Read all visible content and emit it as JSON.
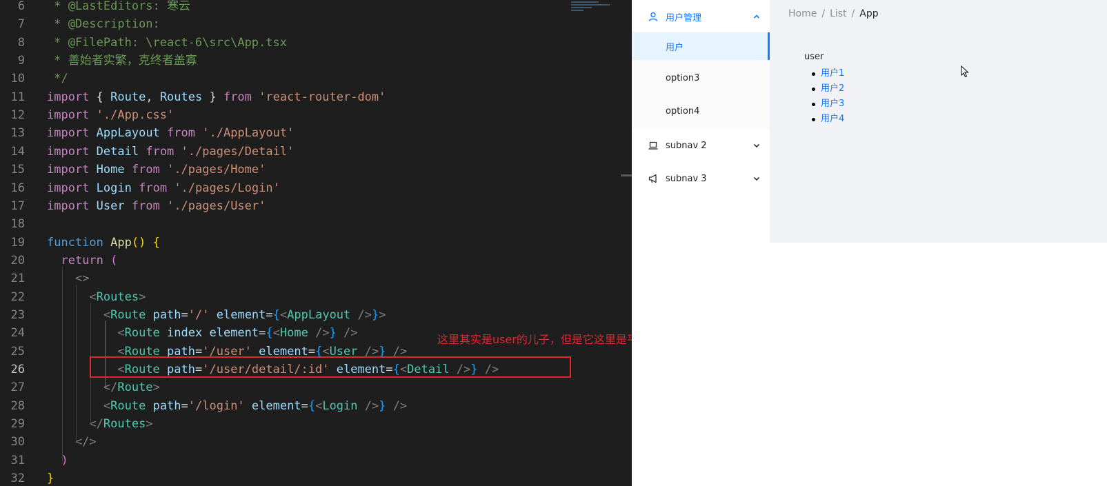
{
  "editor": {
    "lines": [
      {
        "num": "6",
        "tokens": [
          {
            "t": " * @LastEditors: 寒云",
            "c": "c-comment"
          }
        ]
      },
      {
        "num": "7",
        "tokens": [
          {
            "t": " * @Description:",
            "c": "c-comment"
          }
        ]
      },
      {
        "num": "8",
        "tokens": [
          {
            "t": " * @FilePath: \\react-6\\src\\App.tsx",
            "c": "c-comment"
          }
        ]
      },
      {
        "num": "9",
        "tokens": [
          {
            "t": " * 善始者实繁，克终者盖寡",
            "c": "c-comment"
          }
        ]
      },
      {
        "num": "10",
        "tokens": [
          {
            "t": " */",
            "c": "c-comment"
          }
        ]
      },
      {
        "num": "11",
        "tokens": [
          {
            "t": "import",
            "c": "c-kw"
          },
          {
            "t": " { ",
            "c": "c-id"
          },
          {
            "t": "Route",
            "c": "c-var"
          },
          {
            "t": ", ",
            "c": "c-id"
          },
          {
            "t": "Routes",
            "c": "c-var"
          },
          {
            "t": " } ",
            "c": "c-id"
          },
          {
            "t": "from",
            "c": "c-kw"
          },
          {
            "t": " ",
            "c": "c-id"
          },
          {
            "t": "'react-router-dom'",
            "c": "c-str"
          }
        ]
      },
      {
        "num": "12",
        "tokens": [
          {
            "t": "import",
            "c": "c-kw"
          },
          {
            "t": " ",
            "c": "c-id"
          },
          {
            "t": "'./App.css'",
            "c": "c-str"
          }
        ]
      },
      {
        "num": "13",
        "tokens": [
          {
            "t": "import",
            "c": "c-kw"
          },
          {
            "t": " ",
            "c": "c-id"
          },
          {
            "t": "AppLayout",
            "c": "c-var"
          },
          {
            "t": " ",
            "c": "c-id"
          },
          {
            "t": "from",
            "c": "c-kw"
          },
          {
            "t": " ",
            "c": "c-id"
          },
          {
            "t": "'./AppLayout'",
            "c": "c-str"
          }
        ]
      },
      {
        "num": "14",
        "tokens": [
          {
            "t": "import",
            "c": "c-kw"
          },
          {
            "t": " ",
            "c": "c-id"
          },
          {
            "t": "Detail",
            "c": "c-var"
          },
          {
            "t": " ",
            "c": "c-id"
          },
          {
            "t": "from",
            "c": "c-kw"
          },
          {
            "t": " ",
            "c": "c-id"
          },
          {
            "t": "'./pages/Detail'",
            "c": "c-str"
          }
        ]
      },
      {
        "num": "15",
        "tokens": [
          {
            "t": "import",
            "c": "c-kw"
          },
          {
            "t": " ",
            "c": "c-id"
          },
          {
            "t": "Home",
            "c": "c-var"
          },
          {
            "t": " ",
            "c": "c-id"
          },
          {
            "t": "from",
            "c": "c-kw"
          },
          {
            "t": " ",
            "c": "c-id"
          },
          {
            "t": "'./pages/Home'",
            "c": "c-str"
          }
        ]
      },
      {
        "num": "16",
        "tokens": [
          {
            "t": "import",
            "c": "c-kw"
          },
          {
            "t": " ",
            "c": "c-id"
          },
          {
            "t": "Login",
            "c": "c-var"
          },
          {
            "t": " ",
            "c": "c-id"
          },
          {
            "t": "from",
            "c": "c-kw"
          },
          {
            "t": " ",
            "c": "c-id"
          },
          {
            "t": "'./pages/Login'",
            "c": "c-str"
          }
        ]
      },
      {
        "num": "17",
        "tokens": [
          {
            "t": "import",
            "c": "c-kw"
          },
          {
            "t": " ",
            "c": "c-id"
          },
          {
            "t": "User",
            "c": "c-var"
          },
          {
            "t": " ",
            "c": "c-id"
          },
          {
            "t": "from",
            "c": "c-kw"
          },
          {
            "t": " ",
            "c": "c-id"
          },
          {
            "t": "'./pages/User'",
            "c": "c-str"
          }
        ]
      },
      {
        "num": "18",
        "tokens": []
      },
      {
        "num": "19",
        "tokens": [
          {
            "t": "function",
            "c": "c-kw2"
          },
          {
            "t": " ",
            "c": "c-id"
          },
          {
            "t": "App",
            "c": "c-fn"
          },
          {
            "t": "() {",
            "c": "c-brace"
          }
        ]
      },
      {
        "num": "20",
        "tokens": [
          {
            "t": "  ",
            "c": "c-id"
          },
          {
            "t": "return",
            "c": "c-kw"
          },
          {
            "t": " (",
            "c": "c-brace2"
          }
        ]
      },
      {
        "num": "21",
        "tokens": [
          {
            "t": "    ",
            "c": "c-id"
          },
          {
            "t": "<>",
            "c": "c-punc"
          }
        ]
      },
      {
        "num": "22",
        "tokens": [
          {
            "t": "      ",
            "c": "c-id"
          },
          {
            "t": "<",
            "c": "c-punc"
          },
          {
            "t": "Routes",
            "c": "c-tag"
          },
          {
            "t": ">",
            "c": "c-punc"
          }
        ]
      },
      {
        "num": "23",
        "tokens": [
          {
            "t": "        ",
            "c": "c-id"
          },
          {
            "t": "<",
            "c": "c-punc"
          },
          {
            "t": "Route",
            "c": "c-tag"
          },
          {
            "t": " ",
            "c": "c-id"
          },
          {
            "t": "path",
            "c": "c-var"
          },
          {
            "t": "=",
            "c": "c-id"
          },
          {
            "t": "'/'",
            "c": "c-str"
          },
          {
            "t": " ",
            "c": "c-id"
          },
          {
            "t": "element",
            "c": "c-var"
          },
          {
            "t": "=",
            "c": "c-id"
          },
          {
            "t": "{",
            "c": "c-brace3"
          },
          {
            "t": "<",
            "c": "c-punc"
          },
          {
            "t": "AppLayout",
            "c": "c-tag"
          },
          {
            "t": " />",
            "c": "c-punc"
          },
          {
            "t": "}",
            "c": "c-brace3"
          },
          {
            "t": ">",
            "c": "c-punc"
          }
        ]
      },
      {
        "num": "24",
        "tokens": [
          {
            "t": "          ",
            "c": "c-id"
          },
          {
            "t": "<",
            "c": "c-punc"
          },
          {
            "t": "Route",
            "c": "c-tag"
          },
          {
            "t": " ",
            "c": "c-id"
          },
          {
            "t": "index",
            "c": "c-var"
          },
          {
            "t": " ",
            "c": "c-id"
          },
          {
            "t": "element",
            "c": "c-var"
          },
          {
            "t": "=",
            "c": "c-id"
          },
          {
            "t": "{",
            "c": "c-brace3"
          },
          {
            "t": "<",
            "c": "c-punc"
          },
          {
            "t": "Home",
            "c": "c-tag"
          },
          {
            "t": " />",
            "c": "c-punc"
          },
          {
            "t": "}",
            "c": "c-brace3"
          },
          {
            "t": " />",
            "c": "c-punc"
          }
        ]
      },
      {
        "num": "25",
        "tokens": [
          {
            "t": "          ",
            "c": "c-id"
          },
          {
            "t": "<",
            "c": "c-punc"
          },
          {
            "t": "Route",
            "c": "c-tag"
          },
          {
            "t": " ",
            "c": "c-id"
          },
          {
            "t": "path",
            "c": "c-var"
          },
          {
            "t": "=",
            "c": "c-id"
          },
          {
            "t": "'/user'",
            "c": "c-str"
          },
          {
            "t": " ",
            "c": "c-id"
          },
          {
            "t": "element",
            "c": "c-var"
          },
          {
            "t": "=",
            "c": "c-id"
          },
          {
            "t": "{",
            "c": "c-brace3"
          },
          {
            "t": "<",
            "c": "c-punc"
          },
          {
            "t": "User",
            "c": "c-tag"
          },
          {
            "t": " />",
            "c": "c-punc"
          },
          {
            "t": "}",
            "c": "c-brace3"
          },
          {
            "t": " />",
            "c": "c-punc"
          }
        ]
      },
      {
        "num": "26",
        "tokens": [
          {
            "t": "          ",
            "c": "c-id"
          },
          {
            "t": "<",
            "c": "c-punc"
          },
          {
            "t": "Route",
            "c": "c-tag"
          },
          {
            "t": " ",
            "c": "c-id"
          },
          {
            "t": "path",
            "c": "c-var"
          },
          {
            "t": "=",
            "c": "c-id"
          },
          {
            "t": "'/user/detail/:id'",
            "c": "c-str"
          },
          {
            "t": " ",
            "c": "c-id"
          },
          {
            "t": "element",
            "c": "c-var"
          },
          {
            "t": "=",
            "c": "c-id"
          },
          {
            "t": "{",
            "c": "c-brace3"
          },
          {
            "t": "<",
            "c": "c-punc"
          },
          {
            "t": "Detail",
            "c": "c-tag"
          },
          {
            "t": " />",
            "c": "c-punc"
          },
          {
            "t": "}",
            "c": "c-brace3"
          },
          {
            "t": " />",
            "c": "c-punc"
          }
        ]
      },
      {
        "num": "27",
        "tokens": [
          {
            "t": "        ",
            "c": "c-id"
          },
          {
            "t": "</",
            "c": "c-punc"
          },
          {
            "t": "Route",
            "c": "c-tag"
          },
          {
            "t": ">",
            "c": "c-punc"
          }
        ]
      },
      {
        "num": "28",
        "tokens": [
          {
            "t": "        ",
            "c": "c-id"
          },
          {
            "t": "<",
            "c": "c-punc"
          },
          {
            "t": "Route",
            "c": "c-tag"
          },
          {
            "t": " ",
            "c": "c-id"
          },
          {
            "t": "path",
            "c": "c-var"
          },
          {
            "t": "=",
            "c": "c-id"
          },
          {
            "t": "'/login'",
            "c": "c-str"
          },
          {
            "t": " ",
            "c": "c-id"
          },
          {
            "t": "element",
            "c": "c-var"
          },
          {
            "t": "=",
            "c": "c-id"
          },
          {
            "t": "{",
            "c": "c-brace3"
          },
          {
            "t": "<",
            "c": "c-punc"
          },
          {
            "t": "Login",
            "c": "c-tag"
          },
          {
            "t": " />",
            "c": "c-punc"
          },
          {
            "t": "}",
            "c": "c-brace3"
          },
          {
            "t": " />",
            "c": "c-punc"
          }
        ]
      },
      {
        "num": "29",
        "tokens": [
          {
            "t": "      ",
            "c": "c-id"
          },
          {
            "t": "</",
            "c": "c-punc"
          },
          {
            "t": "Routes",
            "c": "c-tag"
          },
          {
            "t": ">",
            "c": "c-punc"
          }
        ]
      },
      {
        "num": "30",
        "tokens": [
          {
            "t": "    ",
            "c": "c-id"
          },
          {
            "t": "</>",
            "c": "c-punc"
          }
        ]
      },
      {
        "num": "31",
        "tokens": [
          {
            "t": "  )",
            "c": "c-brace2"
          }
        ]
      },
      {
        "num": "32",
        "tokens": [
          {
            "t": "}",
            "c": "c-brace"
          }
        ]
      }
    ],
    "active_line": "26",
    "annotation": "这里其实是user的儿子，但是它这里是平级写的",
    "colors": {
      "background": "#1e1e1e",
      "annotation": "#e0262f"
    }
  },
  "app": {
    "menu": {
      "group_user": {
        "label": "用户管理",
        "icon": "user-icon",
        "expanded": true
      },
      "items": [
        {
          "label": "用户",
          "selected": true
        },
        {
          "label": "option3",
          "selected": false
        },
        {
          "label": "option4",
          "selected": false
        }
      ],
      "subnav2": {
        "label": "subnav 2",
        "icon": "laptop-icon"
      },
      "subnav3": {
        "label": "subnav 3",
        "icon": "notification-icon"
      }
    },
    "breadcrumb": [
      {
        "label": "Home",
        "separator": "/"
      },
      {
        "label": "List",
        "separator": "/"
      },
      {
        "label": "App"
      }
    ],
    "page": {
      "title": "user",
      "links": [
        "用户1",
        "用户2",
        "用户3",
        "用户4"
      ]
    },
    "colors": {
      "primary": "#1677ff",
      "selected_bg": "#e6f4ff",
      "content_bg": "#f0f2f5"
    }
  }
}
